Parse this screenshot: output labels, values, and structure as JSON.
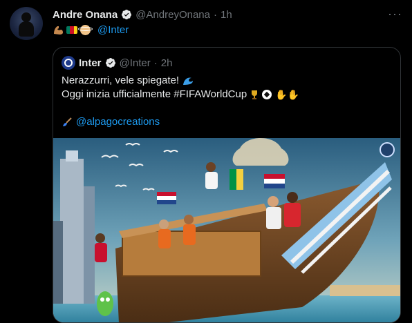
{
  "tweet": {
    "author_name": "Andre Onana",
    "author_handle": "@AndreyOnana",
    "time": "1h",
    "mention": "@Inter"
  },
  "quote": {
    "author_name": "Inter",
    "author_handle": "@Inter",
    "time": "2h",
    "line1": "Nerazzurri, vele spiegate!",
    "line2": "Oggi inizia ufficialmente #FIFAWorldCup",
    "credit": "@alpagocreations"
  },
  "icons": {
    "verified": "verified-badge-icon",
    "more": "more-options-icon",
    "flexed_biceps": "flexed-biceps-emoji",
    "cameroon_flag": "cameroon-flag-emoji",
    "angel_face": "angel-face-emoji",
    "wave": "water-wave-emoji",
    "trophy": "trophy-emoji",
    "soccer_ball": "soccer-ball-emoji",
    "raised_hands": "raising-hands-emoji",
    "paintbrush": "paintbrush-emoji"
  },
  "colors": {
    "background": "#000000",
    "text": "#e7e9ea",
    "secondary": "#71767b",
    "link": "#1d9bf0",
    "border": "#2f3336"
  }
}
